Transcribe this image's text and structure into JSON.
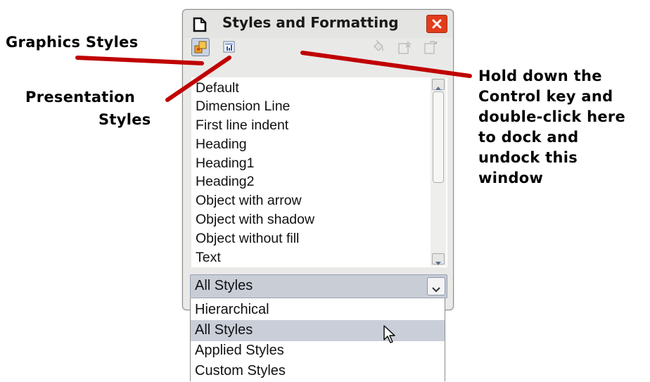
{
  "window": {
    "title": "Styles and Formatting",
    "title_icon": "document-icon",
    "close_icon": "close-icon",
    "accent_close_color": "#e23c1b"
  },
  "toolbar": {
    "buttons": [
      {
        "name": "graphics-styles-button",
        "icon": "graphics-styles-icon",
        "selected": true
      },
      {
        "name": "presentation-styles-button",
        "icon": "presentation-styles-icon",
        "selected": false
      },
      {
        "name": "fill-format-mode-button",
        "icon": "paint-bucket-icon",
        "enabled": false
      },
      {
        "name": "new-style-from-selection-button",
        "icon": "new-style-icon",
        "enabled": false
      },
      {
        "name": "update-style-button",
        "icon": "update-style-icon",
        "enabled": false
      }
    ]
  },
  "styles_list": {
    "items": [
      "Default",
      "Dimension Line",
      "First line indent",
      "Heading",
      "Heading1",
      "Heading2",
      "Object with arrow",
      "Object with shadow",
      "Object without fill",
      "Text"
    ]
  },
  "filter": {
    "selected": "All Styles",
    "options": [
      "Hierarchical",
      "All Styles",
      "Applied Styles",
      "Custom Styles"
    ],
    "highlighted_index": 1
  },
  "annotations": {
    "graphics_styles": "Graphics Styles",
    "presentation_styles_line1": "Presentation",
    "presentation_styles_line2": "Styles",
    "dock_note_lines": [
      "Hold down the",
      "Control key and",
      "double-click here",
      "to dock and",
      "undock this",
      "window"
    ],
    "arrow_color": "#c00000"
  }
}
